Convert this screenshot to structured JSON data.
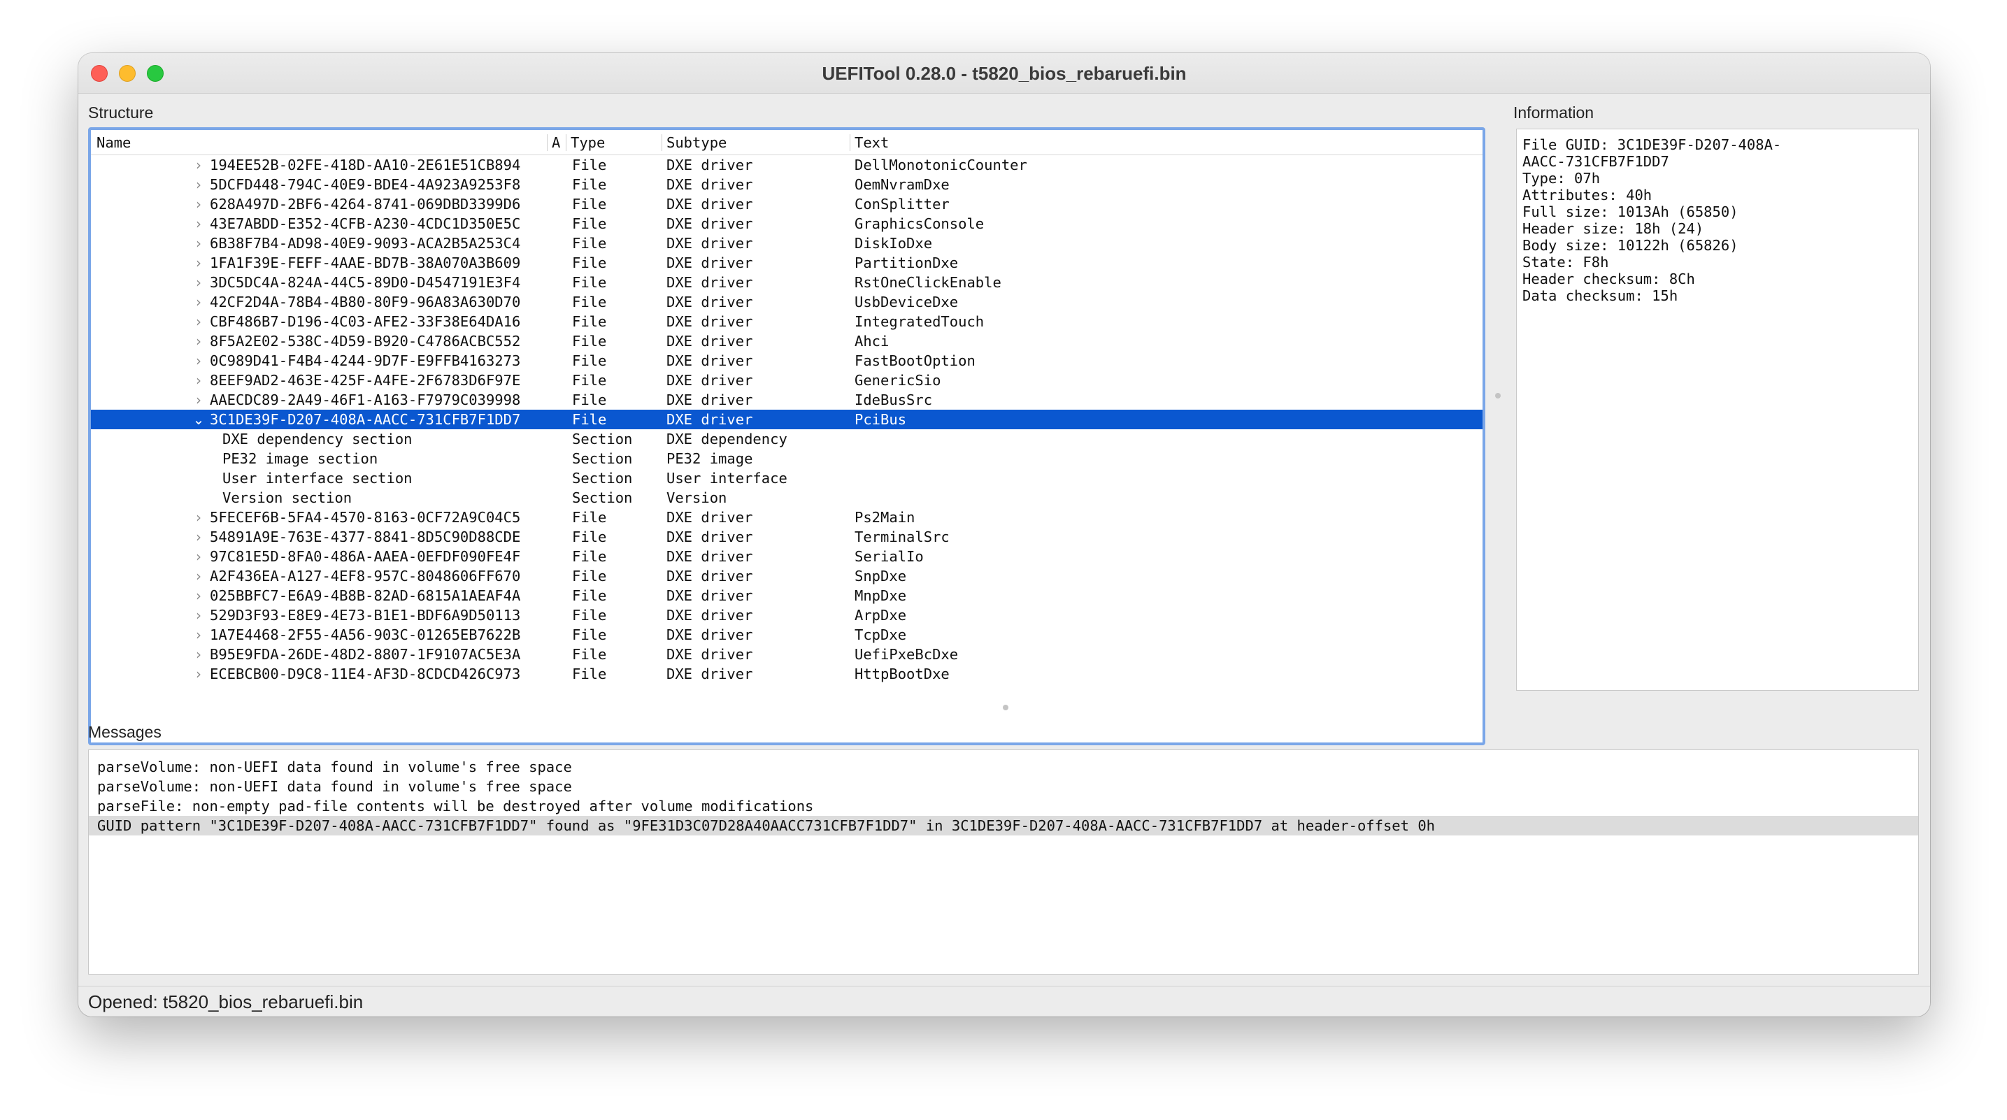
{
  "window": {
    "title": "UEFITool 0.28.0 - t5820_bios_rebaruefi.bin"
  },
  "structure": {
    "label": "Structure",
    "columns": {
      "name": "Name",
      "action": "A",
      "type": "Type",
      "subtype": "Subtype",
      "text": "Text"
    },
    "rows": [
      {
        "name": "194EE52B-02FE-418D-AA10-2E61E51CB894",
        "type": "File",
        "subtype": "DXE driver",
        "text": "DellMonotonicCounter",
        "chevron": "›",
        "level": 0,
        "selected": false
      },
      {
        "name": "5DCFD448-794C-40E9-BDE4-4A923A9253F8",
        "type": "File",
        "subtype": "DXE driver",
        "text": "OemNvramDxe",
        "chevron": "›",
        "level": 0,
        "selected": false
      },
      {
        "name": "628A497D-2BF6-4264-8741-069DBD3399D6",
        "type": "File",
        "subtype": "DXE driver",
        "text": "ConSplitter",
        "chevron": "›",
        "level": 0,
        "selected": false
      },
      {
        "name": "43E7ABDD-E352-4CFB-A230-4CDC1D350E5C",
        "type": "File",
        "subtype": "DXE driver",
        "text": "GraphicsConsole",
        "chevron": "›",
        "level": 0,
        "selected": false
      },
      {
        "name": "6B38F7B4-AD98-40E9-9093-ACA2B5A253C4",
        "type": "File",
        "subtype": "DXE driver",
        "text": "DiskIoDxe",
        "chevron": "›",
        "level": 0,
        "selected": false
      },
      {
        "name": "1FA1F39E-FEFF-4AAE-BD7B-38A070A3B609",
        "type": "File",
        "subtype": "DXE driver",
        "text": "PartitionDxe",
        "chevron": "›",
        "level": 0,
        "selected": false
      },
      {
        "name": "3DC5DC4A-824A-44C5-89D0-D4547191E3F4",
        "type": "File",
        "subtype": "DXE driver",
        "text": "RstOneClickEnable",
        "chevron": "›",
        "level": 0,
        "selected": false
      },
      {
        "name": "42CF2D4A-78B4-4B80-80F9-96A83A630D70",
        "type": "File",
        "subtype": "DXE driver",
        "text": "UsbDeviceDxe",
        "chevron": "›",
        "level": 0,
        "selected": false
      },
      {
        "name": "CBF486B7-D196-4C03-AFE2-33F38E64DA16",
        "type": "File",
        "subtype": "DXE driver",
        "text": "IntegratedTouch",
        "chevron": "›",
        "level": 0,
        "selected": false
      },
      {
        "name": "8F5A2E02-538C-4D59-B920-C4786ACBC552",
        "type": "File",
        "subtype": "DXE driver",
        "text": "Ahci",
        "chevron": "›",
        "level": 0,
        "selected": false
      },
      {
        "name": "0C989D41-F4B4-4244-9D7F-E9FFB4163273",
        "type": "File",
        "subtype": "DXE driver",
        "text": "FastBootOption",
        "chevron": "›",
        "level": 0,
        "selected": false
      },
      {
        "name": "8EEF9AD2-463E-425F-A4FE-2F6783D6F97E",
        "type": "File",
        "subtype": "DXE driver",
        "text": "GenericSio",
        "chevron": "›",
        "level": 0,
        "selected": false
      },
      {
        "name": "AAECDC89-2A49-46F1-A163-F7979C039998",
        "type": "File",
        "subtype": "DXE driver",
        "text": "IdeBusSrc",
        "chevron": "›",
        "level": 0,
        "selected": false
      },
      {
        "name": "3C1DE39F-D207-408A-AACC-731CFB7F1DD7",
        "type": "File",
        "subtype": "DXE driver",
        "text": "PciBus",
        "chevron": "⌄",
        "level": 0,
        "selected": true
      },
      {
        "name": "DXE dependency section",
        "type": "Section",
        "subtype": "DXE dependency",
        "text": "",
        "chevron": "",
        "level": 1,
        "selected": false
      },
      {
        "name": "PE32 image section",
        "type": "Section",
        "subtype": "PE32 image",
        "text": "",
        "chevron": "",
        "level": 1,
        "selected": false
      },
      {
        "name": "User interface section",
        "type": "Section",
        "subtype": "User interface",
        "text": "",
        "chevron": "",
        "level": 1,
        "selected": false
      },
      {
        "name": "Version section",
        "type": "Section",
        "subtype": "Version",
        "text": "",
        "chevron": "",
        "level": 1,
        "selected": false
      },
      {
        "name": "5FECEF6B-5FA4-4570-8163-0CF72A9C04C5",
        "type": "File",
        "subtype": "DXE driver",
        "text": "Ps2Main",
        "chevron": "›",
        "level": 0,
        "selected": false
      },
      {
        "name": "54891A9E-763E-4377-8841-8D5C90D88CDE",
        "type": "File",
        "subtype": "DXE driver",
        "text": "TerminalSrc",
        "chevron": "›",
        "level": 0,
        "selected": false
      },
      {
        "name": "97C81E5D-8FA0-486A-AAEA-0EFDF090FE4F",
        "type": "File",
        "subtype": "DXE driver",
        "text": "SerialIo",
        "chevron": "›",
        "level": 0,
        "selected": false
      },
      {
        "name": "A2F436EA-A127-4EF8-957C-8048606FF670",
        "type": "File",
        "subtype": "DXE driver",
        "text": "SnpDxe",
        "chevron": "›",
        "level": 0,
        "selected": false
      },
      {
        "name": "025BBFC7-E6A9-4B8B-82AD-6815A1AEAF4A",
        "type": "File",
        "subtype": "DXE driver",
        "text": "MnpDxe",
        "chevron": "›",
        "level": 0,
        "selected": false
      },
      {
        "name": "529D3F93-E8E9-4E73-B1E1-BDF6A9D50113",
        "type": "File",
        "subtype": "DXE driver",
        "text": "ArpDxe",
        "chevron": "›",
        "level": 0,
        "selected": false
      },
      {
        "name": "1A7E4468-2F55-4A56-903C-01265EB7622B",
        "type": "File",
        "subtype": "DXE driver",
        "text": "TcpDxe",
        "chevron": "›",
        "level": 0,
        "selected": false
      },
      {
        "name": "B95E9FDA-26DE-48D2-8807-1F9107AC5E3A",
        "type": "File",
        "subtype": "DXE driver",
        "text": "UefiPxeBcDxe",
        "chevron": "›",
        "level": 0,
        "selected": false
      },
      {
        "name": "ECEBCB00-D9C8-11E4-AF3D-8CDCD426C973",
        "type": "File",
        "subtype": "DXE driver",
        "text": "HttpBootDxe",
        "chevron": "›",
        "level": 0,
        "selected": false
      }
    ]
  },
  "information": {
    "label": "Information",
    "lines": [
      "File GUID: 3C1DE39F-D207-408A-",
      "AACC-731CFB7F1DD7",
      "Type: 07h",
      "Attributes: 40h",
      "Full size: 1013Ah (65850)",
      "Header size: 18h (24)",
      "Body size: 10122h (65826)",
      "State: F8h",
      "Header checksum: 8Ch",
      "Data checksum: 15h"
    ]
  },
  "messages": {
    "label": "Messages",
    "items": [
      {
        "text": "parseVolume: non-UEFI data found in volume's free space",
        "highlight": false
      },
      {
        "text": "parseVolume: non-UEFI data found in volume's free space",
        "highlight": false
      },
      {
        "text": "parseFile: non-empty pad-file contents will be destroyed after volume modifications",
        "highlight": false
      },
      {
        "text": "GUID pattern \"3C1DE39F-D207-408A-AACC-731CFB7F1DD7\" found as \"9FE31D3C07D28A40AACC731CFB7F1DD7\" in 3C1DE39F-D207-408A-AACC-731CFB7F1DD7 at header-offset 0h",
        "highlight": true
      }
    ]
  },
  "status": {
    "text": "Opened: t5820_bios_rebaruefi.bin"
  },
  "colors": {
    "selection": "#0a57d0",
    "focus_ring": "#7aa6e8",
    "message_highlight": "#dcdcdc"
  }
}
